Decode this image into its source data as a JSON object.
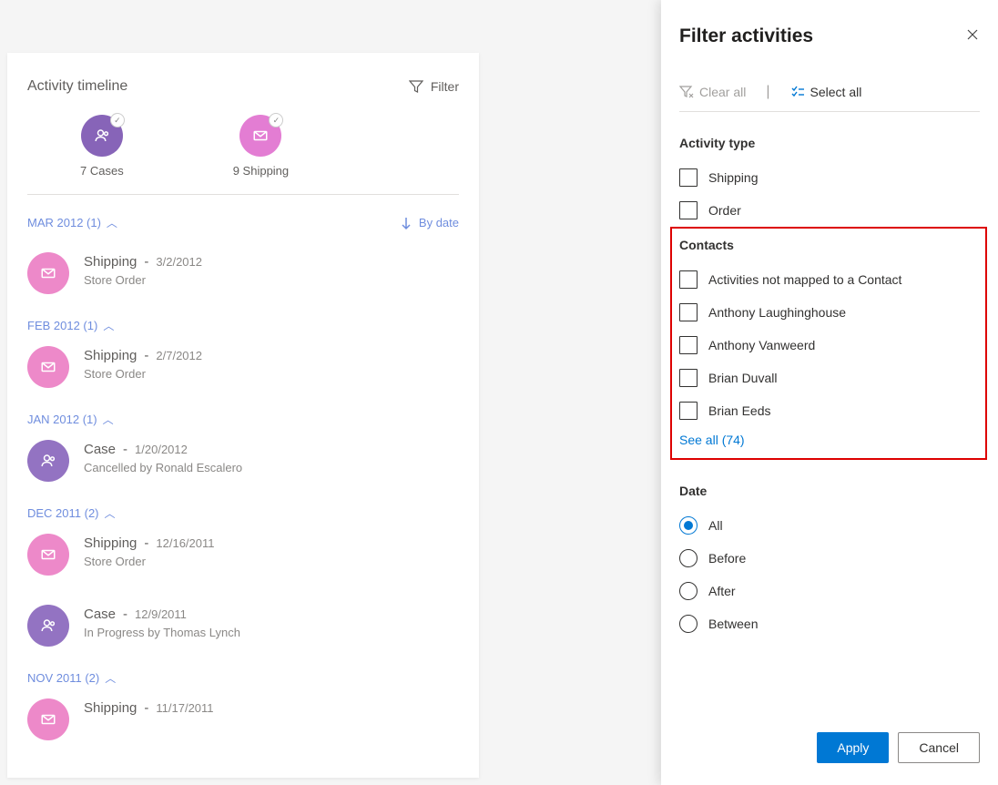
{
  "timeline": {
    "title": "Activity timeline",
    "filter_label": "Filter",
    "sort_label": "By date",
    "summary": [
      {
        "count_label": "7 Cases",
        "kind": "cases"
      },
      {
        "count_label": "9 Shipping",
        "kind": "shipping"
      }
    ],
    "groups": [
      {
        "header": "MAR 2012 (1)",
        "entries": [
          {
            "type": "Shipping",
            "date": "3/2/2012",
            "sub": "Store Order",
            "icon": "shipping"
          }
        ]
      },
      {
        "header": "FEB 2012 (1)",
        "entries": [
          {
            "type": "Shipping",
            "date": "2/7/2012",
            "sub": "Store Order",
            "icon": "shipping"
          }
        ]
      },
      {
        "header": "JAN 2012 (1)",
        "entries": [
          {
            "type": "Case",
            "date": "1/20/2012",
            "sub": "Cancelled by Ronald Escalero",
            "icon": "case"
          }
        ]
      },
      {
        "header": "DEC 2011 (2)",
        "entries": [
          {
            "type": "Shipping",
            "date": "12/16/2011",
            "sub": "Store Order",
            "icon": "shipping"
          },
          {
            "type": "Case",
            "date": "12/9/2011",
            "sub": "In Progress by Thomas Lynch",
            "icon": "case"
          }
        ]
      },
      {
        "header": "NOV 2011 (2)",
        "entries": [
          {
            "type": "Shipping",
            "date": "11/17/2011",
            "sub": "",
            "icon": "shipping"
          }
        ]
      }
    ]
  },
  "panel": {
    "title": "Filter activities",
    "clear_label": "Clear all",
    "select_label": "Select all",
    "activity_type": {
      "title": "Activity type",
      "options": [
        "Shipping",
        "Order"
      ]
    },
    "contacts": {
      "title": "Contacts",
      "options": [
        "Activities not mapped to a Contact",
        "Anthony Laughinghouse",
        "Anthony Vanweerd",
        "Brian Duvall",
        "Brian Eeds"
      ],
      "see_all": "See all (74)"
    },
    "date": {
      "title": "Date",
      "options": [
        "All",
        "Before",
        "After",
        "Between"
      ],
      "selected": "All"
    },
    "apply": "Apply",
    "cancel": "Cancel"
  }
}
